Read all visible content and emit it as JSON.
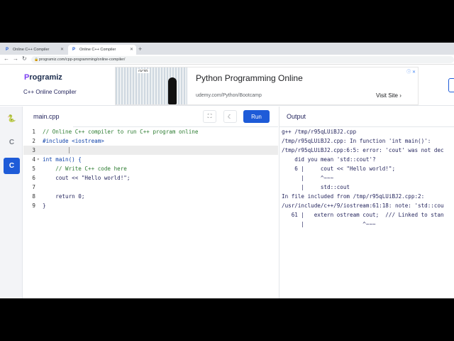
{
  "browser": {
    "tabs": [
      {
        "title": "Online C++ Compiler",
        "active": false
      },
      {
        "title": "Online C++ Compiler",
        "active": true
      }
    ],
    "url": "programiz.com/cpp-programming/online-compiler/"
  },
  "header": {
    "logo_text": "rogramiz",
    "subtitle": "C++ Online Compiler"
  },
  "ad": {
    "badge": "מודעה",
    "title": "Python Programming Online",
    "url": "udemy.com/Python/Bootcamp",
    "cta": "Visit Site ›"
  },
  "editor": {
    "filename": "main.cpp",
    "run_label": "Run",
    "lines": [
      {
        "num": "1",
        "text": "// Online C++ compiler to run C++ program online"
      },
      {
        "num": "2",
        "text": "#include <iostream>"
      },
      {
        "num": "3",
        "text": ""
      },
      {
        "num": "4",
        "text": "int main() {"
      },
      {
        "num": "5",
        "text": "    // Write C++ code here"
      },
      {
        "num": "6",
        "text": "    cout << \"Hello world!\";"
      },
      {
        "num": "7",
        "text": ""
      },
      {
        "num": "8",
        "text": "    return 0;"
      },
      {
        "num": "9",
        "text": "}"
      }
    ]
  },
  "output": {
    "title": "Output",
    "lines": [
      "g++ /tmp/r95qLUiBJ2.cpp",
      "/tmp/r95qLUiBJ2.cpp: In function 'int main()':",
      "/tmp/r95qLUiBJ2.cpp:6:5: error: 'cout' was not dec",
      "    did you mean 'std::cout'?",
      "    6 |     cout << \"Hello world!\";",
      "      |     ^~~~",
      "      |     std::cout",
      "In file included from /tmp/r95qLUiBJ2.cpp:2:",
      "/usr/include/c++/9/iostream:61:18: note: 'std::cou",
      "   61 |   extern ostream cout;  /// Linked to stan",
      "      |                  ^~~~"
    ]
  },
  "colors": {
    "accent": "#1e5bd8",
    "comment": "#2e7d32",
    "keyword": "#0b3fa8",
    "string": "#c62828",
    "output_text": "#25265e"
  }
}
